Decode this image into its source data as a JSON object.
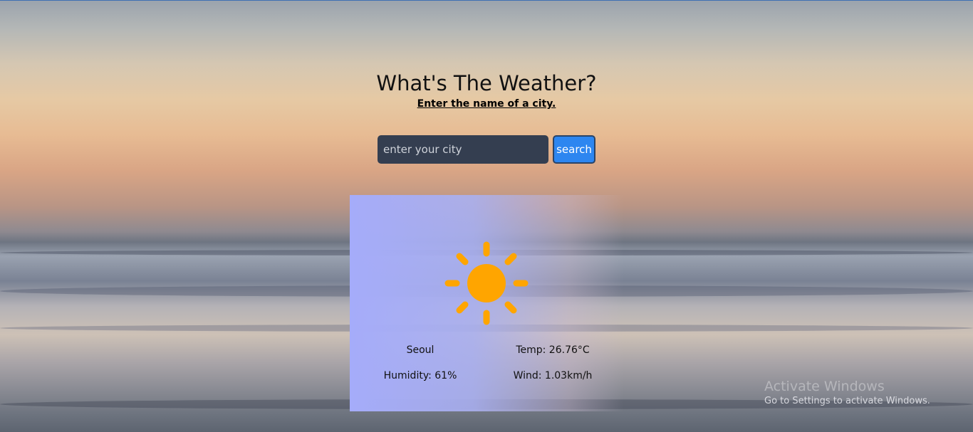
{
  "header": {
    "title": "What's The Weather?",
    "subtitle": "Enter the name of a city."
  },
  "search": {
    "placeholder": "enter your city",
    "value": "",
    "button_label": "search"
  },
  "weather": {
    "icon": "sun-icon",
    "city": "Seoul",
    "temp": "Temp: 26.76°C",
    "humidity": "Humidity: 61%",
    "wind": "Wind: 1.03km/h"
  },
  "watermark": {
    "title": "Activate Windows",
    "subtitle": "Go to Settings to activate Windows."
  },
  "colors": {
    "input_bg": "#343e50",
    "button_bg": "#2d86f0",
    "card_bg": "#a5acfa",
    "sun": "#ffa500"
  }
}
